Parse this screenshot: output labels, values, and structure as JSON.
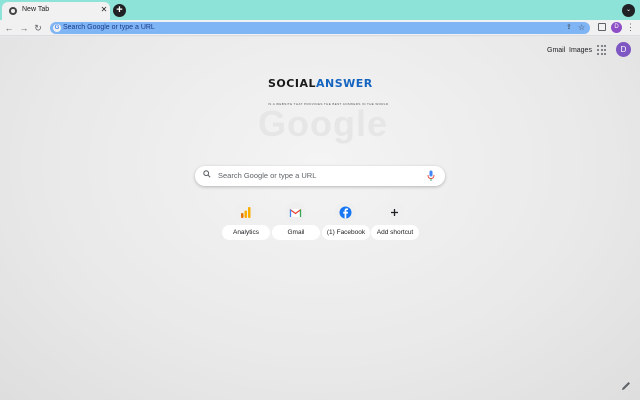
{
  "tab": {
    "title": "New Tab",
    "close": "✕"
  },
  "toolbar": {
    "back": "←",
    "forward": "→",
    "reload": "↻",
    "omnibox_text": "Search Google or type a URL",
    "profile_initial": "D"
  },
  "page": {
    "gmail_link": "Gmail",
    "images_link": "Images",
    "avatar_initial": "D",
    "doodle": {
      "part1": "SOCIAL",
      "part2": "ANSWER",
      "tagline": "IS A WEBSITE THAT PROVIDES THE BEST ANSWERS IN THE WORLD"
    },
    "ghost_logo": "Google",
    "search_placeholder": "Search Google or type a URL",
    "shortcuts": [
      {
        "label": "Analytics",
        "icon": "analytics-icon"
      },
      {
        "label": "Gmail",
        "icon": "gmail-icon"
      },
      {
        "label": "(1) Facebook",
        "icon": "facebook-icon"
      },
      {
        "label": "Add shortcut",
        "icon": "plus-icon"
      }
    ]
  },
  "colors": {
    "tabstrip": "#8de3d8",
    "omnibox": "#7fb4f5",
    "avatar": "#7e57c2"
  }
}
